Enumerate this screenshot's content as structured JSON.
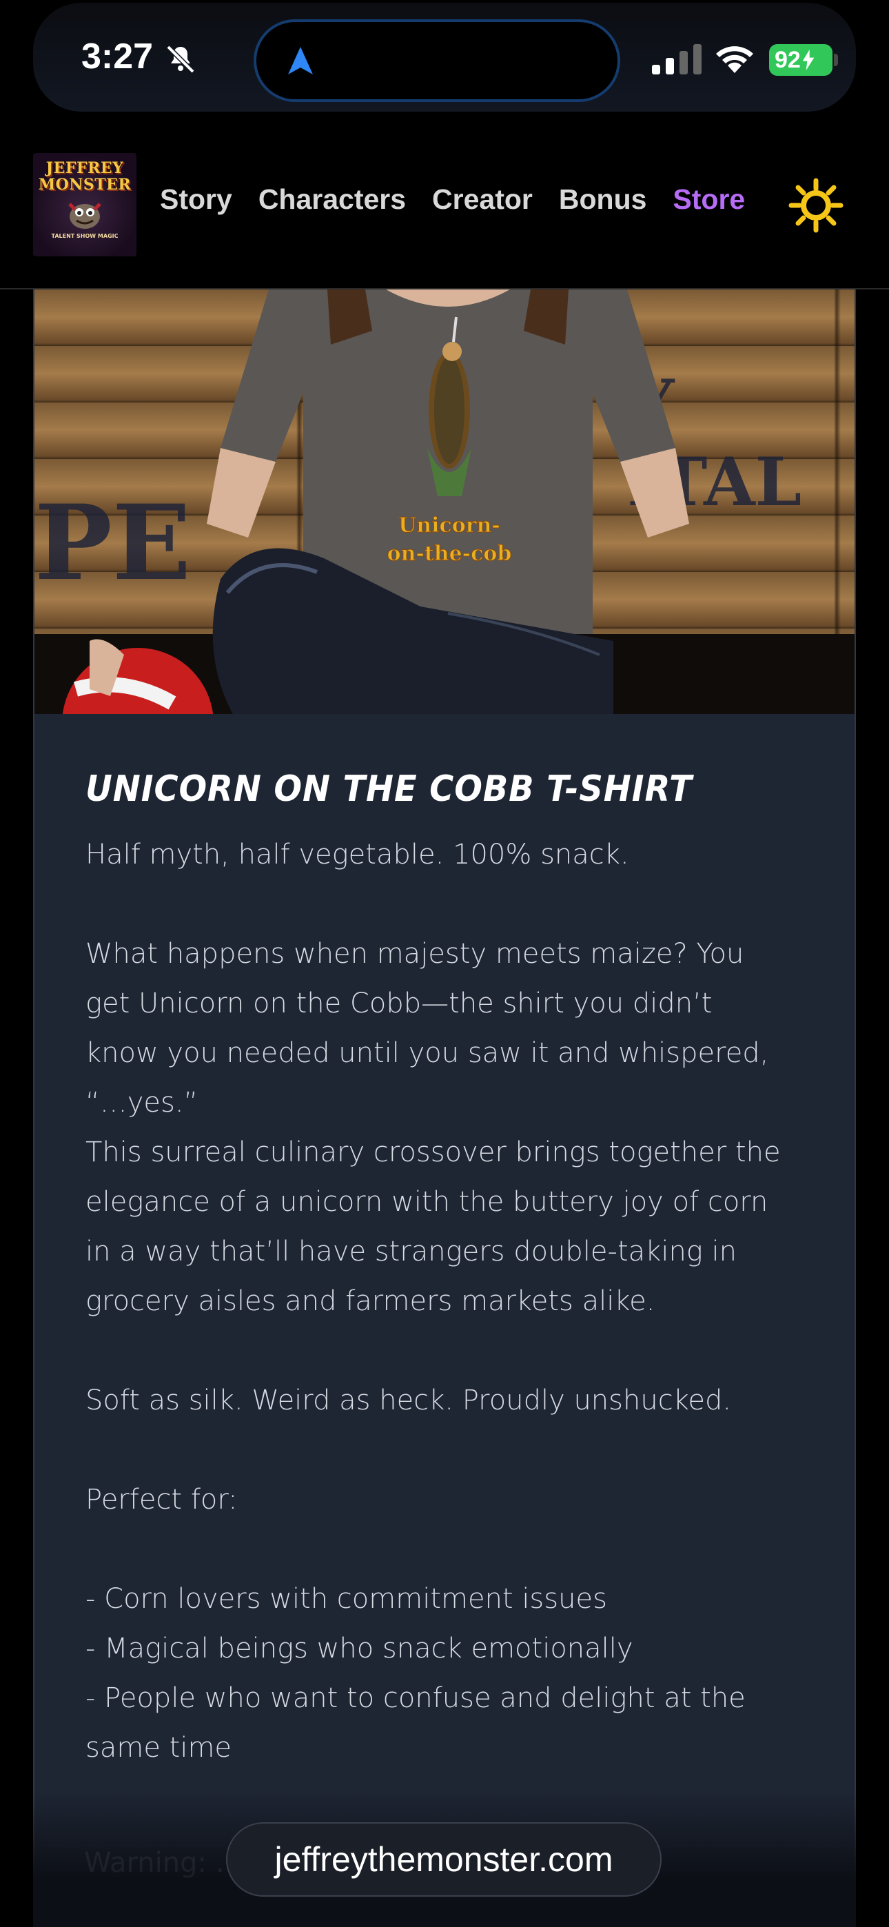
{
  "status_bar": {
    "time": "3:27",
    "battery": "92",
    "icons": [
      "bell-slash-icon",
      "navigation-arrow-icon",
      "signal-icon",
      "wifi-icon",
      "battery-charging-icon"
    ]
  },
  "header": {
    "logo": {
      "line1": "JEFFREY",
      "line2": "MONSTER",
      "tagline": "TALENT SHOW MAGIC"
    },
    "nav": [
      "Story",
      "Characters",
      "Creator",
      "Bonus",
      "Store"
    ],
    "active_nav": "Store",
    "active_color": "#b66cf5",
    "theme_icon": "sun-icon"
  },
  "hero": {
    "shirt_print": {
      "line1": "Unicorn-",
      "line2": "on-the-cob"
    },
    "stencil_left": "PE",
    "stencil_right": "Y ITAL"
  },
  "product": {
    "title": "UNICORN ON THE COBB T-SHIRT",
    "tagline": "Half myth, half vegetable. 100% snack.",
    "para1_line1": "What happens when majesty meets maize? You",
    "para1_line2": "get Unicorn on the Cobb—the shirt you didn’t",
    "para1_line3": "know you needed until you saw it and whispered,",
    "para1_line4": "“…yes.”",
    "para2_line1": "This surreal culinary crossover brings together the",
    "para2_line2": "elegance of a unicorn with the buttery joy of corn",
    "para2_line3": "in a way that’ll have strangers double-taking in",
    "para2_line4": "grocery aisles and farmers markets alike.",
    "para3": "Soft as silk. Weird as heck. Proudly unshucked.",
    "perfect_for": "Perfect for:",
    "list": [
      "- Corn lovers with commitment issues",
      "- Magical beings who snack emotionally",
      "- People who want to confuse and delight at the",
      "same time"
    ],
    "warning_partial": "Warning: …"
  },
  "browser": {
    "url": "jeffreythemonster.com"
  }
}
